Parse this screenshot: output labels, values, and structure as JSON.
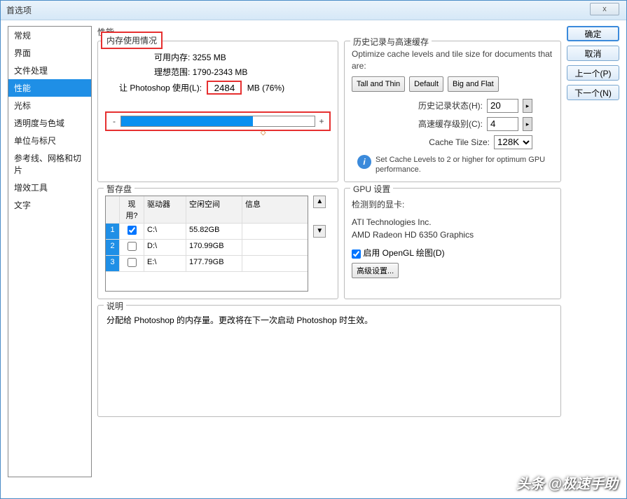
{
  "window": {
    "title": "首选项",
    "close": "x"
  },
  "sidebar": {
    "items": [
      {
        "label": "常规"
      },
      {
        "label": "界面"
      },
      {
        "label": "文件处理"
      },
      {
        "label": "性能"
      },
      {
        "label": "光标"
      },
      {
        "label": "透明度与色域"
      },
      {
        "label": "单位与标尺"
      },
      {
        "label": "参考线、网格和切片"
      },
      {
        "label": "增效工具"
      },
      {
        "label": "文字"
      }
    ],
    "selected_index": 3
  },
  "buttons": {
    "ok": "确定",
    "cancel": "取消",
    "prev": "上一个(P)",
    "next": "下一个(N)"
  },
  "page_title": "性能",
  "memory": {
    "legend": "内存使用情况",
    "avail_label": "可用内存:",
    "avail_value": "3255 MB",
    "ideal_label": "理想范围:",
    "ideal_value": "1790-2343 MB",
    "let_label": "让 Photoshop 使用(L):",
    "value": "2484",
    "suffix": "MB (76%)",
    "minus": "-",
    "plus": "+"
  },
  "history": {
    "legend": "历史记录与高速缓存",
    "optimize_text": "Optimize cache levels and tile size for documents that are:",
    "preset_tall": "Tall and Thin",
    "preset_default": "Default",
    "preset_big": "Big and Flat",
    "states_label": "历史记录状态(H):",
    "states_value": "20",
    "cache_label": "高速缓存级别(C):",
    "cache_value": "4",
    "tile_label": "Cache Tile Size:",
    "tile_value": "128K",
    "info": "Set Cache Levels to 2 or higher for optimum GPU performance."
  },
  "scratch": {
    "legend": "暂存盘",
    "col_active": "现用?",
    "col_drive": "驱动器",
    "col_free": "空闲空间",
    "col_info": "信息",
    "rows": [
      {
        "idx": "1",
        "active": true,
        "drive": "C:\\",
        "free": "55.82GB",
        "info": ""
      },
      {
        "idx": "2",
        "active": false,
        "drive": "D:\\",
        "free": "170.99GB",
        "info": ""
      },
      {
        "idx": "3",
        "active": false,
        "drive": "E:\\",
        "free": "177.79GB",
        "info": ""
      }
    ]
  },
  "gpu": {
    "legend": "GPU 设置",
    "detected_label": "检测到的显卡:",
    "vendor": "ATI Technologies Inc.",
    "card": "AMD Radeon HD 6350 Graphics",
    "enable_label": "启用 OpenGL 绘图(D)",
    "advanced": "高级设置..."
  },
  "desc": {
    "legend": "说明",
    "text": "分配给 Photoshop 的内存量。更改将在下一次启动 Photoshop 时生效。"
  },
  "watermark": "头条 @极速手助"
}
